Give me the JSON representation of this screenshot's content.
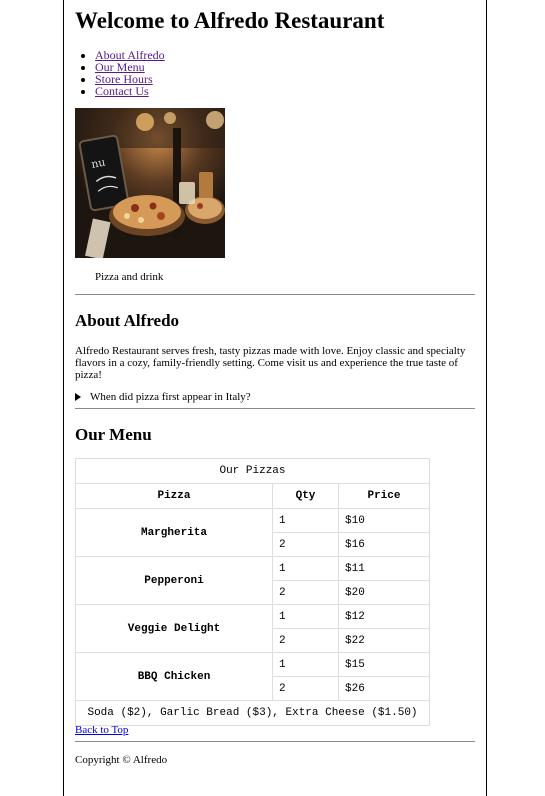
{
  "header": {
    "title": "Welcome to Alfredo Restaurant"
  },
  "nav": {
    "items": [
      "About Alfredo",
      "Our Menu",
      "Store Hours",
      "Contact Us"
    ]
  },
  "figure": {
    "caption": "Pizza and drink"
  },
  "about": {
    "heading": "About Alfredo",
    "text": "Alfredo Restaurant serves fresh, tasty pizzas made with love. Enjoy classic and specialty flavors in a cozy, family-friendly setting. Come visit us and experience the true taste of pizza!",
    "summary": "When did pizza first appear in Italy?"
  },
  "menu": {
    "heading": "Our Menu",
    "table": {
      "caption": "Our Pizzas",
      "headers": [
        "Pizza",
        "Qty",
        "Price"
      ],
      "rows": [
        {
          "name": "Margherita",
          "q1": "1",
          "p1": "$10",
          "q2": "2",
          "p2": "$16"
        },
        {
          "name": "Pepperoni",
          "q1": "1",
          "p1": "$11",
          "q2": "2",
          "p2": "$20"
        },
        {
          "name": "Veggie Delight",
          "q1": "1",
          "p1": "$12",
          "q2": "2",
          "p2": "$22"
        },
        {
          "name": "BBQ Chicken",
          "q1": "1",
          "p1": "$15",
          "q2": "2",
          "p2": "$26"
        }
      ],
      "footer": "Soda ($2), Garlic Bread ($3), Extra Cheese ($1.50)"
    }
  },
  "back_to_top": "Back to Top",
  "footer": {
    "copyright": "Copyright © Alfredo"
  }
}
